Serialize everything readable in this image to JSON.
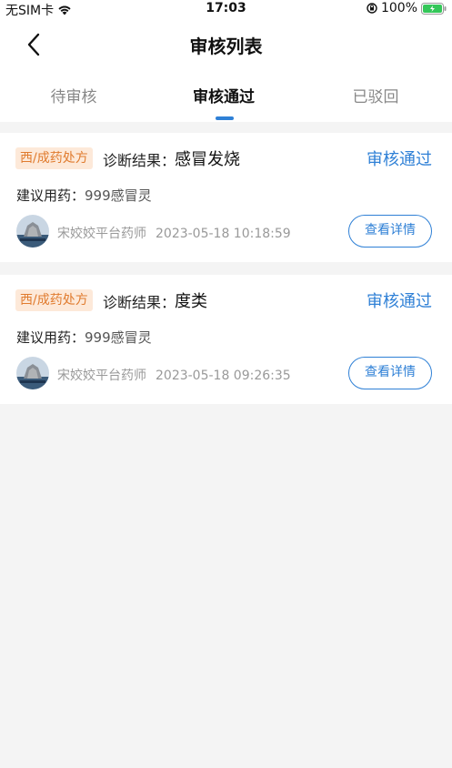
{
  "status_bar": {
    "carrier": "无SIM卡",
    "time": "17:03",
    "battery": "100%"
  },
  "header": {
    "title": "审核列表",
    "back_icon": "chevron-left-icon"
  },
  "tabs": [
    {
      "label": "待审核",
      "active": false
    },
    {
      "label": "审核通过",
      "active": true
    },
    {
      "label": "已驳回",
      "active": false
    }
  ],
  "colors": {
    "accent": "#2f80d6",
    "tag_bg": "#fde9d9",
    "tag_text": "#e07b2e"
  },
  "records": [
    {
      "tag": "西/成药处方",
      "diagnosis_label": "诊断结果：",
      "diagnosis": "感冒发烧",
      "status": "审核通过",
      "drug_label": "建议用药：",
      "drug": "999感冒灵",
      "pharmacist": "宋姣姣平台药师",
      "time": "2023-05-18 10:18:59",
      "detail_label": "查看详情"
    },
    {
      "tag": "西/成药处方",
      "diagnosis_label": "诊断结果：",
      "diagnosis": "度类",
      "status": "审核通过",
      "drug_label": "建议用药：",
      "drug": "999感冒灵",
      "pharmacist": "宋姣姣平台药师",
      "time": "2023-05-18 09:26:35",
      "detail_label": "查看详情"
    }
  ]
}
